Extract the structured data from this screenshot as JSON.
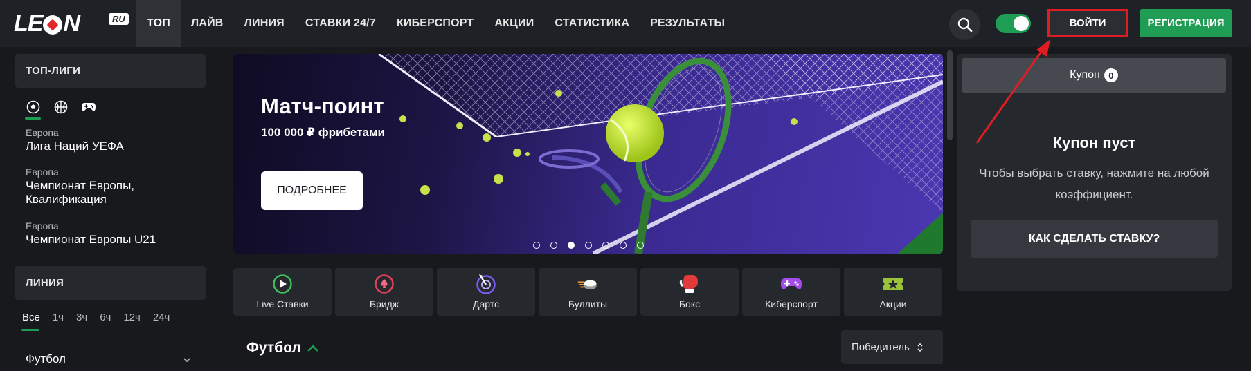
{
  "header": {
    "logo_text_1": "LE",
    "logo_text_2": "N",
    "logo_badge": "RU",
    "nav": [
      "ТОП",
      "ЛАЙВ",
      "ЛИНИЯ",
      "СТАВКИ 24/7",
      "КИБЕРСПОРТ",
      "АКЦИИ",
      "СТАТИСТИКА",
      "РЕЗУЛЬТАТЫ"
    ],
    "login_label": "ВОЙТИ",
    "register_label": "РЕГИСТРАЦИЯ",
    "accent_color": "#1f9d55",
    "highlight_color": "#e11c24"
  },
  "sidebar": {
    "top_leagues_title": "ТОП-ЛИГИ",
    "sport_icons": [
      "football-icon",
      "basketball-icon",
      "esports-gamepad-icon"
    ],
    "leagues": [
      {
        "region": "Европа",
        "name": "Лига Наций УЕФА"
      },
      {
        "region": "Европа",
        "name": "Чемпионат Европы,",
        "name2": "Квалификация"
      },
      {
        "region": "Европа",
        "name": "Чемпионат Европы U21"
      }
    ],
    "line_title": "ЛИНИЯ",
    "time_filters": [
      "Все",
      "1ч",
      "3ч",
      "6ч",
      "12ч",
      "24ч"
    ],
    "sport_row": "Футбол"
  },
  "banner": {
    "title": "Матч-поинт",
    "subtitle": "100 000 ₽ фрибетами",
    "button": "ПОДРОБНЕЕ",
    "slides_count": 7,
    "active_slide": 3
  },
  "categories": [
    {
      "label": "Live Ставки",
      "icon": "live-play-icon",
      "color": "#3fbf5a"
    },
    {
      "label": "Бридж",
      "icon": "spade-icon",
      "color": "#e0405a"
    },
    {
      "label": "Дартс",
      "icon": "dartboard-icon",
      "color": "#7a5cf0"
    },
    {
      "label": "Буллиты",
      "icon": "hockey-puck-icon",
      "color": "#e8902a"
    },
    {
      "label": "Бокс",
      "icon": "boxing-glove-icon",
      "color": "#e03a3a"
    },
    {
      "label": "Киберспорт",
      "icon": "gamepad-icon",
      "color": "#a44ce8"
    },
    {
      "label": "Акции",
      "icon": "ticket-star-icon",
      "color": "#9ac23a"
    }
  ],
  "main": {
    "section_title": "Футбол",
    "market_select": "Победитель"
  },
  "coupon": {
    "tab_label": "Купон",
    "count": "0",
    "empty_title": "Купон пуст",
    "hint": "Чтобы выбрать ставку, нажмите на любой коэффициент.",
    "howto_button": "КАК СДЕЛАТЬ СТАВКУ?"
  }
}
